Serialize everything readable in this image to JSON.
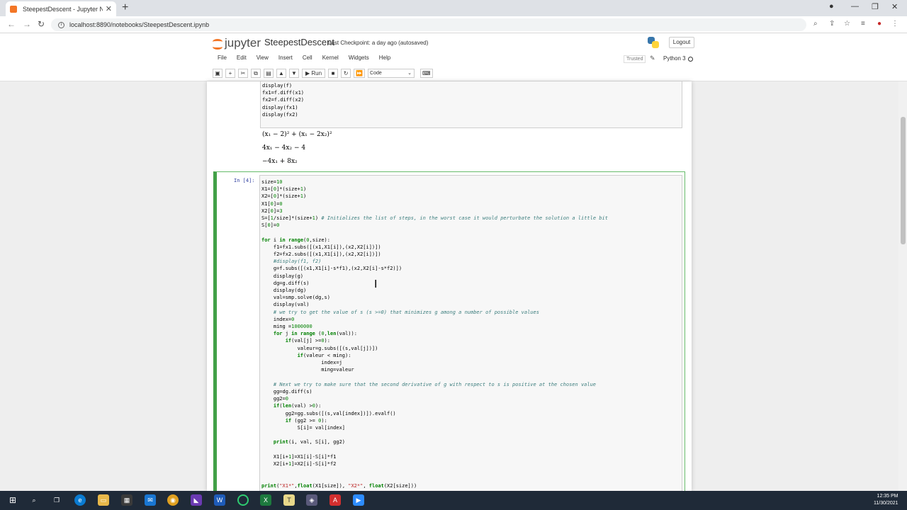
{
  "browser": {
    "tab_title": "SteepestDescent - Jupyter Notebo",
    "url": "localhost:8890/notebooks/SteepestDescent.ipynb"
  },
  "jupyter": {
    "logo_text": "jupyter",
    "notebook_name": "SteepestDescent",
    "checkpoint": "Last Checkpoint: a day ago  (autosaved)",
    "logout": "Logout",
    "menu": [
      "File",
      "Edit",
      "View",
      "Insert",
      "Cell",
      "Kernel",
      "Widgets",
      "Help"
    ],
    "trusted": "Trusted",
    "kernel": "Python 3",
    "toolbar": {
      "run_label": "Run",
      "cell_type": "Code"
    }
  },
  "cell1": {
    "code": [
      "display(f)",
      "fx1=f.diff(x1)",
      "fx2=f.diff(x2)",
      "display(fx1)",
      "display(fx2)"
    ]
  },
  "outputs": [
    "(x₁ − 2)² + (x₁ − 2x₂)²",
    "4x₁ − 4x₂ − 4",
    "−4x₁ + 8x₂"
  ],
  "cell2": {
    "prompt": "In [4]:",
    "code": [
      "size=10",
      "X1=[0]*(size+1)",
      "X2=[0]*(size+1)",
      "X1[0]=0",
      "X2[0]=3",
      "S=[1/size]*(size+1) # Initializes the list of steps, in the worst case it would perturbate the solution a little bit",
      "S[0]=0",
      "",
      "for i in range(0,size):",
      "    f1=fx1.subs([(x1,X1[i]),(x2,X2[i])])",
      "    f2=fx2.subs([(x1,X1[i]),(x2,X2[i])])",
      "    #display(f1, f2)",
      "    g=f.subs([(x1,X1[i]-s*f1),(x2,X2[i]-s*f2)])",
      "    display(g)",
      "    dg=g.diff(s)",
      "    display(dg)",
      "    val=smp.solve(dg,s)",
      "    display(val)",
      "    # we try to get the value of s (s >=0) that minimizes g among a number of possible values",
      "    index=0",
      "    ming =1000000",
      "    for j in range (0,len(val)):",
      "        if(val[j] >=0):",
      "            valeur=g.subs([(s,val[j])])",
      "            if(valeur < ming):",
      "                    index=j",
      "                    ming=valeur",
      "",
      "    # Next we try to make sure that the second derivative of g with respect to s is positive at the chosen value",
      "    gg=dg.diff(s)",
      "    gg2=0",
      "    if(len(val) >0):",
      "        gg2=gg.subs([(s,val[index])]).evalf()",
      "        if (gg2 >= 0):",
      "            S[i]= val[index]",
      "",
      "    print(i, val, S[i], gg2)",
      "",
      "    X1[i+1]=X1[i]-S[i]*f1",
      "    X2[i+1]=X2[i]-S[i]*f2",
      "",
      "",
      "print(\"X1*\",float(X1[size]), \"X2*\", float(X2[size]))"
    ]
  },
  "taskbar": {
    "time": "12:35 PM",
    "date": "11/30/2021"
  }
}
